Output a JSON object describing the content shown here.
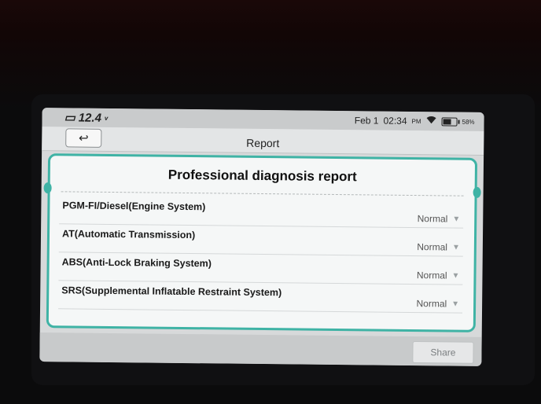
{
  "status_bar": {
    "voltage": "12.4",
    "voltage_unit": "v",
    "date": "Feb 1",
    "time": "02:34",
    "ampm": "PM",
    "battery": "58%"
  },
  "header": {
    "back_icon": "back-arrow-icon",
    "title": "Report"
  },
  "report": {
    "heading": "Professional diagnosis report",
    "systems": [
      {
        "name": "PGM-FI/Diesel(Engine System)",
        "status": "Normal"
      },
      {
        "name": "AT(Automatic Transmission)",
        "status": "Normal"
      },
      {
        "name": "ABS(Anti-Lock Braking System)",
        "status": "Normal"
      },
      {
        "name": "SRS(Supplemental Inflatable Restraint System)",
        "status": "Normal"
      }
    ]
  },
  "footer": {
    "share_label": "Share"
  },
  "colors": {
    "accent": "#3fb3a5"
  }
}
